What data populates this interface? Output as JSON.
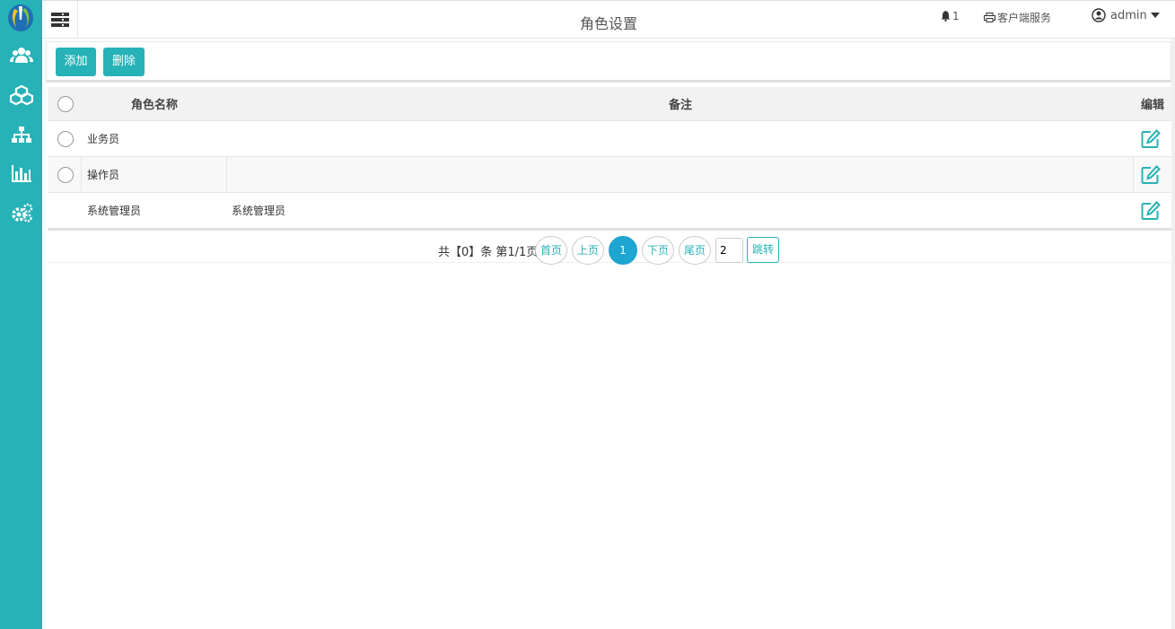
{
  "header": {
    "title": "角色设置",
    "notifications_count": "1",
    "client_service_label": "客户端服务",
    "user_label": "admin"
  },
  "sidebar": {
    "items": [
      {
        "name": "users",
        "icon": "users-icon"
      },
      {
        "name": "cubes",
        "icon": "cubes-icon"
      },
      {
        "name": "sitemap",
        "icon": "sitemap-icon"
      },
      {
        "name": "chart",
        "icon": "bar-chart-icon"
      },
      {
        "name": "settings",
        "icon": "cogs-icon"
      }
    ]
  },
  "toolbar": {
    "add_label": "添加",
    "delete_label": "删除"
  },
  "table": {
    "columns": [
      "角色名称",
      "备注",
      "编辑"
    ],
    "rows": [
      {
        "name": "业务员",
        "note": "",
        "has_radio": true
      },
      {
        "name": "操作员",
        "note": "",
        "has_radio": true
      },
      {
        "name": "系统管理员",
        "note": "系统管理员",
        "has_radio": false
      }
    ]
  },
  "pagination": {
    "summary": "共【0】条 第1/1页",
    "first": "首页",
    "prev": "上页",
    "current": "1",
    "next": "下页",
    "last": "尾页",
    "jump_value": "2",
    "jump_label": "跳转"
  },
  "colors": {
    "accent": "#27b2b7",
    "active_page": "#1ea5d1"
  }
}
